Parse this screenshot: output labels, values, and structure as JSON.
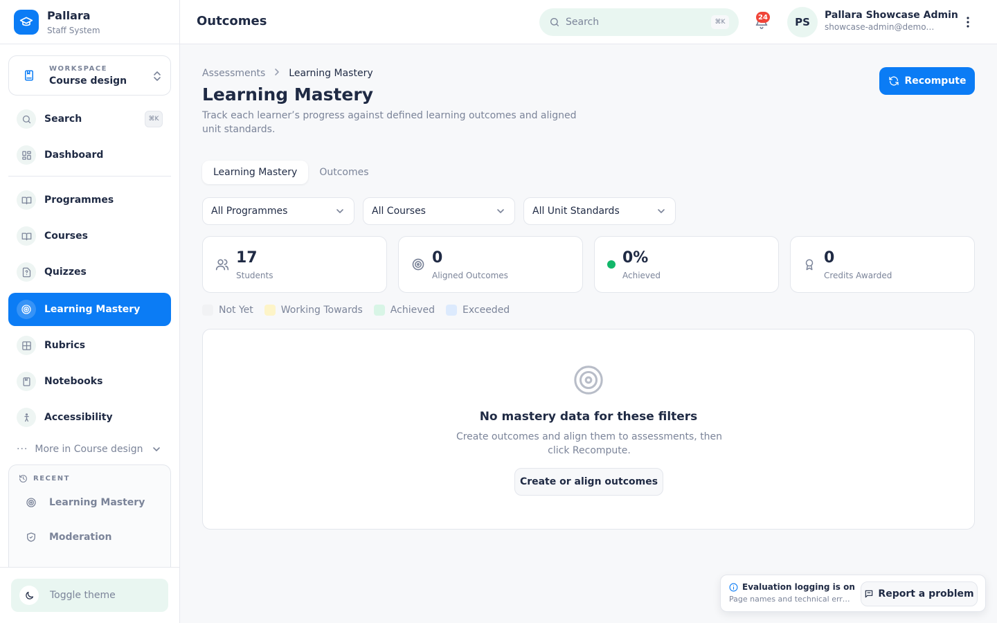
{
  "brand": {
    "name": "Pallara",
    "subtitle": "Staff System"
  },
  "workspace": {
    "label": "WORKSPACE",
    "value": "Course design"
  },
  "sidebar": {
    "search_label": "Search",
    "search_shortcut": "⌘K",
    "items": [
      {
        "label": "Dashboard",
        "icon": "grid-icon"
      },
      {
        "label": "Programmes",
        "icon": "book-open-icon"
      },
      {
        "label": "Courses",
        "icon": "book-open-icon"
      },
      {
        "label": "Quizzes",
        "icon": "quiz-icon"
      },
      {
        "label": "Learning Mastery",
        "icon": "target-icon",
        "active": true
      },
      {
        "label": "Rubrics",
        "icon": "rubric-icon"
      },
      {
        "label": "Notebooks",
        "icon": "notebook-icon"
      },
      {
        "label": "Accessibility",
        "icon": "accessibility-icon"
      }
    ],
    "more_label": "More in Course design",
    "recent_label": "RECENT",
    "recent_items": [
      {
        "label": "Learning Mastery",
        "icon": "target-icon"
      },
      {
        "label": "Moderation",
        "icon": "shield-icon"
      }
    ],
    "toggle_theme": "Toggle theme"
  },
  "topbar": {
    "title": "Outcomes",
    "search_placeholder": "Search",
    "search_shortcut": "⌘K",
    "notification_count": "24",
    "avatar_initials": "PS",
    "user_name": "Pallara Showcase Admin",
    "user_email": "showcase-admin@demo.pallara.com"
  },
  "page": {
    "breadcrumb": [
      "Assessments",
      "Learning Mastery"
    ],
    "title": "Learning Mastery",
    "description": "Track each learner’s progress against defined learning outcomes and aligned unit standards.",
    "recompute_label": "Recompute",
    "tabs": [
      "Learning Mastery",
      "Outcomes"
    ],
    "active_tab": "Learning Mastery",
    "filters": [
      "All Programmes",
      "All Courses",
      "All Unit Standards"
    ]
  },
  "stats": [
    {
      "value": "17",
      "label": "Students",
      "icon": "users-icon"
    },
    {
      "value": "0",
      "label": "Aligned Outcomes",
      "icon": "target-icon"
    },
    {
      "value": "0%",
      "label": "Achieved",
      "icon": "status-dot-icon"
    },
    {
      "value": "0",
      "label": "Credits Awarded",
      "icon": "award-icon"
    }
  ],
  "legend": [
    {
      "label": "Not Yet",
      "color": "#f1f2f4"
    },
    {
      "label": "Working Towards",
      "color": "#fdf4c8"
    },
    {
      "label": "Achieved",
      "color": "#d8f5e6"
    },
    {
      "label": "Exceeded",
      "color": "#dceafd"
    }
  ],
  "empty_state": {
    "title": "No mastery data for these filters",
    "text": "Create outcomes and align them to assessments, then click Recompute.",
    "button": "Create or align outcomes"
  },
  "toast": {
    "title": "Evaluation logging is on",
    "subtitle": "Page names and technical errors are logged to help improve the system.",
    "button": "Report a problem"
  },
  "colors": {
    "accent": "#0b7cf5",
    "success": "#12b76a",
    "badge": "#f04438"
  }
}
